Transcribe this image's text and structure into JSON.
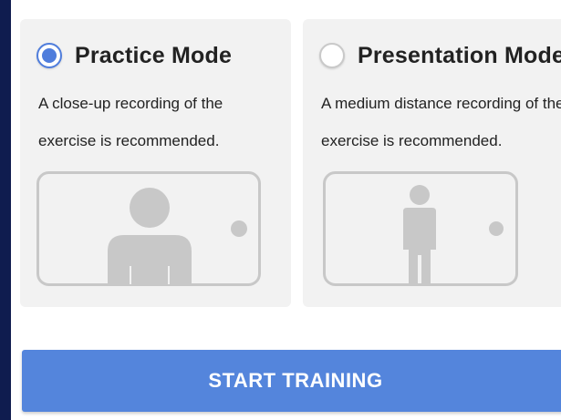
{
  "modes": [
    {
      "title": "Practice Mode",
      "description": "A close-up recording of the exercise is recommended.",
      "selected": true,
      "illustration": "close-up-person-in-phone-frame"
    },
    {
      "title": "Presentation Mode",
      "description": "A medium distance recording of the exercise is recommended.",
      "selected": false,
      "illustration": "full-body-person-in-phone-frame"
    }
  ],
  "actions": {
    "start_label": "START TRAINING"
  },
  "colors": {
    "accent": "#4f7ddc",
    "button": "#5485dc",
    "card_bg": "#f2f2f2",
    "frame_bg": "#0f1c4f",
    "illustration": "#c8c8c8"
  }
}
